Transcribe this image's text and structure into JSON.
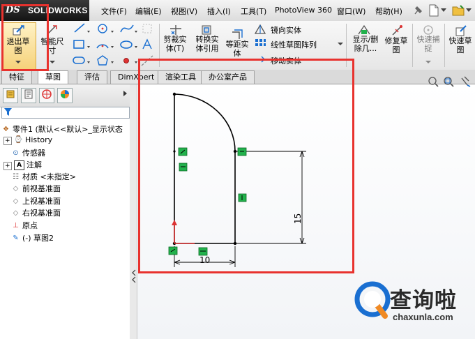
{
  "app": {
    "logo_prefix": "DS",
    "logo_name": "SOLIDWORKS"
  },
  "menu": [
    {
      "id": "file",
      "label": "文件(F)"
    },
    {
      "id": "edit",
      "label": "编辑(E)"
    },
    {
      "id": "view",
      "label": "视图(V)"
    },
    {
      "id": "insert",
      "label": "插入(I)"
    },
    {
      "id": "tools",
      "label": "工具(T)"
    },
    {
      "id": "photoview",
      "label": "PhotoView 360"
    },
    {
      "id": "window",
      "label": "窗口(W)"
    },
    {
      "id": "help",
      "label": "帮助(H)"
    }
  ],
  "ribbon": {
    "exit_sketch": "退出草\n图",
    "smart_dim": "智能尺\n寸",
    "trim": "剪裁实\n体(T)",
    "convert": "转换实\n体引用",
    "offset": "等距实\n体",
    "mirror": "镜向实体",
    "linear_pattern": "线性草图阵列",
    "move": "移动实体",
    "display_delete": "显示/删\n除几...",
    "repair": "修复草\n图",
    "quick_snap": "快速捕\n捉",
    "rapid_sketch": "快速草\n图"
  },
  "tabs": [
    {
      "id": "features",
      "label": "特征"
    },
    {
      "id": "sketch",
      "label": "草图"
    },
    {
      "id": "evaluate",
      "label": "评估"
    },
    {
      "id": "dimxpert",
      "label": "DimXpert"
    },
    {
      "id": "render",
      "label": "渲染工具"
    },
    {
      "id": "office",
      "label": "办公室产品"
    }
  ],
  "tree": [
    {
      "label": "零件1 (默认<<默认>_显示状态"
    },
    {
      "label": "History"
    },
    {
      "label": "传感器"
    },
    {
      "label": "注解"
    },
    {
      "label": "材质 <未指定>"
    },
    {
      "label": "前视基准面"
    },
    {
      "label": "上视基准面"
    },
    {
      "label": "右视基准面"
    },
    {
      "label": "原点"
    },
    {
      "label": "(-) 草图2"
    }
  ],
  "sketch": {
    "dim_horizontal": "10",
    "dim_vertical": "15"
  },
  "colors": {
    "highlight": "#e8322e",
    "constraint": "#22b14c",
    "accent_blue": "#1a6fd1"
  },
  "watermark": {
    "title": "查询啦",
    "url": "chaxunla.com"
  }
}
